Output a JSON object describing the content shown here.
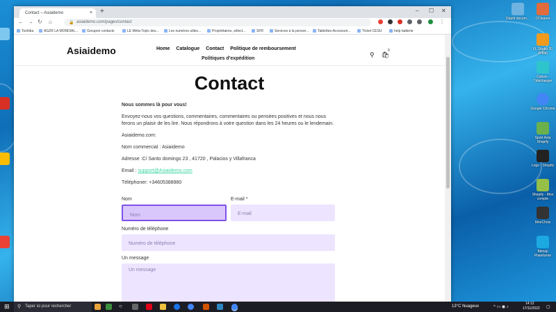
{
  "desktop": {
    "icons": [
      {
        "label": "Dépôt docum...",
        "color": "#6fb3e0"
      },
      {
        "label": "CCleaner",
        "color": "#e06b3c"
      },
      {
        "label": "FL Studio 20 (64bit)",
        "color": "#f19a1e"
      },
      {
        "label": "Canva - Télécharger",
        "color": "#2ec4cc"
      },
      {
        "label": "Google Chrome",
        "color": "#4285f4"
      },
      {
        "label": "Sport Asia Shopify",
        "color": "#6ab04c"
      },
      {
        "label": "Logo - Shopify",
        "color": "#222"
      },
      {
        "label": "Shopify - Mon compte",
        "color": "#95bf47"
      },
      {
        "label": "MonChoix",
        "color": "#333"
      },
      {
        "label": "Bitmoji Plateforme",
        "color": "#1ca8e0"
      }
    ]
  },
  "browser": {
    "tab_title": "Contact – Asiaidemo",
    "url": "asiaidemo.com/pages/contact",
    "bookmarks": [
      "Toshiba",
      "AGZR LA MONDIAL...",
      "Groupon contacts",
      "LE Méta-Topic des...",
      "Les numéros utiles...",
      "Propriétaires, sélect...",
      "SFR",
      "Services à la person...",
      "Tablettes-Accessoir...",
      "Ticket CESU",
      "help batterie"
    ]
  },
  "site": {
    "logo": "Asiaidemo",
    "nav": [
      "Home",
      "Catalogue",
      "Contact",
      "Politique de remboursement"
    ],
    "nav_second_line": "Politiques d'expédition",
    "cart_count": "0"
  },
  "contact": {
    "title": "Contact",
    "intro_bold": "Nous sommes là pour vous!",
    "intro": "Envoyez-nous vos questions, commentaires, commentaires ou pensées positives et nous nous ferons un plaisir de les lire. Nous répondrons à votre question dans les 24 heures ou le lendemain.",
    "site_line": "Asiaidemo.com:",
    "company_line": "Nom commercial : Asiaidemo",
    "address_line": "Adresse :C/ Santo domingo 23 , 41720 , Palacios y Villafranca",
    "email_prefix": "Email : ",
    "email": "support@Asiaidemo.com",
    "phone_line": "Téléphoner: +34605388980"
  },
  "form": {
    "name_label": "Nom",
    "name_placeholder": "Nom",
    "email_label": "E-mail *",
    "email_placeholder": "E-mail",
    "phone_label": "Numéro de téléphone",
    "phone_placeholder": "Numéro de téléphone",
    "message_label": "Un message",
    "message_placeholder": "Un message"
  },
  "taskbar": {
    "search_placeholder": "Taper ici pour rechercher",
    "weather": "13°C  Nuageux",
    "time": "14:12",
    "date": "17/11/2022"
  }
}
